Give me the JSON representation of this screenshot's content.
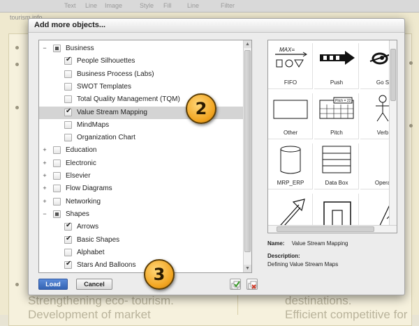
{
  "background": {
    "toolbar_items": [
      "Text",
      "Line",
      "Image",
      "Style",
      "Fill",
      "Line",
      "Filter"
    ],
    "breadcrumb": "tourism info",
    "bottom_left_text": "Strengthening eco- tourism.",
    "bottom_left_text2": "Development of market",
    "bottom_right_text": "destinations.",
    "bottom_right_text2": "Efficient competitive for"
  },
  "dialog": {
    "title": "Add more objects...",
    "tree": [
      {
        "label": "Business",
        "level": 0,
        "expander": "−",
        "state": "partial",
        "selected": false
      },
      {
        "label": "People Silhouettes",
        "level": 1,
        "state": "checked",
        "selected": false
      },
      {
        "label": "Business Process (Labs)",
        "level": 1,
        "state": "unchecked",
        "selected": false
      },
      {
        "label": "SWOT Templates",
        "level": 1,
        "state": "unchecked",
        "selected": false
      },
      {
        "label": "Total Quality Management (TQM)",
        "level": 1,
        "state": "unchecked",
        "selected": false
      },
      {
        "label": "Value Stream Mapping",
        "level": 1,
        "state": "checked",
        "selected": true
      },
      {
        "label": "MindMaps",
        "level": 1,
        "state": "unchecked",
        "selected": false
      },
      {
        "label": "Organization Chart",
        "level": 1,
        "state": "unchecked",
        "selected": false
      },
      {
        "label": "Education",
        "level": 0,
        "expander": "+",
        "state": "unchecked",
        "selected": false
      },
      {
        "label": "Electronic",
        "level": 0,
        "expander": "+",
        "state": "unchecked",
        "selected": false
      },
      {
        "label": "Elsevier",
        "level": 0,
        "expander": "+",
        "state": "unchecked",
        "selected": false
      },
      {
        "label": "Flow Diagrams",
        "level": 0,
        "expander": "+",
        "state": "unchecked",
        "selected": false
      },
      {
        "label": "Networking",
        "level": 0,
        "expander": "+",
        "state": "unchecked",
        "selected": false
      },
      {
        "label": "Shapes",
        "level": 0,
        "expander": "−",
        "state": "partial",
        "selected": false
      },
      {
        "label": "Arrows",
        "level": 1,
        "state": "checked",
        "selected": false
      },
      {
        "label": "Basic Shapes",
        "level": 1,
        "state": "checked",
        "selected": false
      },
      {
        "label": "Alphabet",
        "level": 1,
        "state": "unchecked",
        "selected": false
      },
      {
        "label": "Stars And Balloons",
        "level": 1,
        "state": "checked",
        "selected": false
      }
    ],
    "preview_tiles": [
      {
        "label": "FIFO",
        "icon": "fifo-icon",
        "shape_text": "MAX="
      },
      {
        "label": "Push",
        "icon": "push-arrow-icon"
      },
      {
        "label": "Go S",
        "icon": "go-see-icon"
      },
      {
        "label": "Other",
        "icon": "other-rectangle-icon"
      },
      {
        "label": "Pitch",
        "icon": "pitch-icon",
        "shape_text": "Pitch = 22"
      },
      {
        "label": "Verb",
        "icon": "operator-icon"
      },
      {
        "label": "MRP_ERP",
        "icon": "mrp-erp-cylinder-icon"
      },
      {
        "label": "Data Box",
        "icon": "data-box-icon"
      },
      {
        "label": "Opera",
        "icon": "operation-arc-icon"
      },
      {
        "label": "",
        "icon": "diagonal-arrow-icon"
      },
      {
        "label": "",
        "icon": "box-outline-icon"
      },
      {
        "label": "",
        "icon": "peak-icon"
      }
    ],
    "info": {
      "name_key": "Name:",
      "name_value": "Value Stream Mapping",
      "description_key": "Description:",
      "description_value": "Defining Value Stream Maps"
    },
    "buttons": {
      "load": "Load",
      "cancel": "Cancel"
    },
    "colors": {
      "load_button": "#3d6fc1",
      "callout": "#f2a521"
    }
  },
  "callouts": {
    "two": "2",
    "three": "3"
  }
}
